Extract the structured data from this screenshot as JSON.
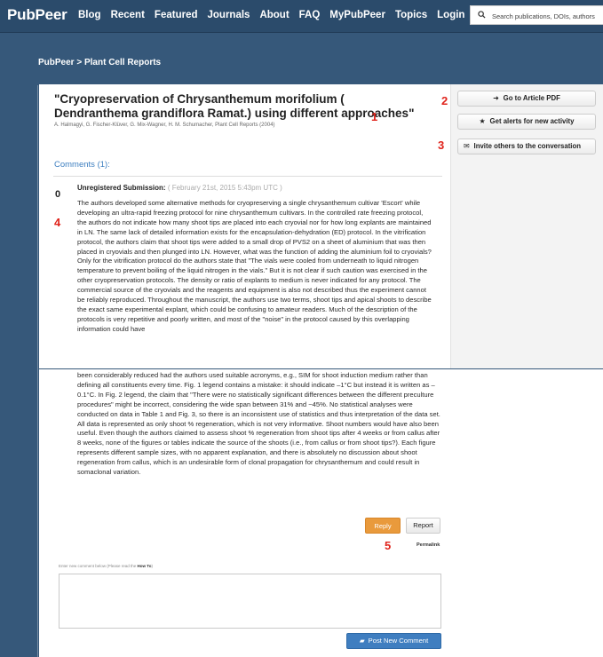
{
  "header": {
    "brand": "PubPeer",
    "nav": [
      "Blog",
      "Recent",
      "Featured",
      "Journals",
      "About",
      "FAQ",
      "MyPubPeer",
      "Topics",
      "Login"
    ],
    "search_placeholder": "Search publications, DOIs, authors"
  },
  "breadcrumb": "PubPeer > Plant Cell Reports",
  "article": {
    "title": "\"Cryopreservation of Chrysanthemum morifolium ( Dendranthema grandiflora Ramat.) using different approaches\"",
    "authors": "A. Halmagyi, G. Fischer-Klüver, G. Mix-Wagner, H. M. Schumacher, Plant Cell Reports (2004)"
  },
  "sidebar": {
    "go_to_pdf": "Go to Article PDF",
    "get_alerts": "Get alerts for new activity",
    "invite": "Invite others to the conversation"
  },
  "annotations": [
    "1",
    "2",
    "3",
    "4",
    "5"
  ],
  "comments": {
    "count_label": "Comments (1):",
    "item": {
      "votes": "0",
      "author": "Unregistered Submission:",
      "date": "( February 21st, 2015 5:43pm UTC )",
      "text_part1": "The authors developed some alternative methods for cryopreserving a single chrysanthemum cultivar 'Escort' while developing an ultra-rapid freezing protocol for nine chrysanthemum cultivars. In the controlled rate freezing protocol, the authors do not indicate how many shoot tips are placed into each cryovial nor for how long explants are maintained in LN. The same lack of detailed information exists for the encapsulation-dehydration (ED) protocol. In the vitrification protocol, the authors claim that shoot tips were added to a small drop of PVS2 on a sheet of aluminium that was then placed in cryovials and then plunged into LN. However, what was the function of adding the aluminium foil to cryovials? Only for the vitrification protocol do the authors state that \"The vials were cooled from underneath to liquid nitrogen temperature to prevent boiling of the liquid nitrogen in the vials.\" But it is not clear if such caution was exercised in the other cryopreservation protocols. The density or ratio of explants to medium is never indicated for any protocol. The commercial source of the cryovials and the reagents and equipment is also not described thus the experiment cannot be reliably reproduced. Throughout the manuscript, the authors use two terms, shoot tips and apical shoots to describe the exact same experimental explant, which could be confusing to amateur readers. Much of the description of the protocols is very repetitive and poorly written, and most of the \"noise\" in the protocol caused by this overlapping information could have",
      "text_part2": "been considerably reduced had the authors used suitable acronyms, e.g., SIM for shoot induction medium rather than defining all constituents every time. Fig. 1 legend contains a mistake: it should indicate –1°C but instead it is written as –0.1°C. In Fig. 2 legend, the claim that \"There were no statistically significant differences between the different preculture procedures\" might be incorrect, considering the wide span between 31% and ~45%. No statistical analyses were conducted on data in Table 1 and Fig. 3, so there is an inconsistent use of statistics and thus interpretation of the data set. All data is represented as only shoot % regeneration, which is not very informative. Shoot numbers would have also been useful. Even though the authors claimed to assess shoot % regeneration from shoot tips after 4 weeks or from callus after 8 weeks, none of the figures or tables indicate the source of the shoots (i.e., from callus or from shoot tips?). Each figure represents different sample sizes, with no apparent explanation, and there is absolutely no discussion about shoot regeneration from callus, which is an undesirable form of clonal propagation for chrysanthemum and could result in somaclonal variation.",
      "reply_label": "Reply",
      "report_label": "Report",
      "permalink_label": "Permalink"
    }
  },
  "new_comment": {
    "hint": "Enter new comment below (Please read the ",
    "hint_link": "How To",
    "hint_end": ")",
    "post_label": "Post New Comment"
  },
  "colors": {
    "background": "#36587a",
    "link": "#3e7fc0",
    "reply": "#e99a3c",
    "post": "#3f7ec0",
    "annotation": "#e0241c"
  }
}
